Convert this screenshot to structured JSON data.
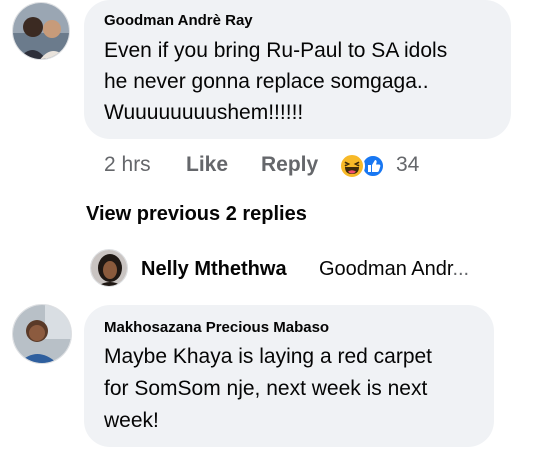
{
  "comments": [
    {
      "author": "Goodman Andrè Ray",
      "lines": [
        "Even if you bring Ru-Paul to SA idols",
        "he never gonna replace somgaga..",
        "Wuuuuuuuushem!!!!!!"
      ],
      "time": "2 hrs",
      "like_label": "Like",
      "reply_label": "Reply",
      "reaction_count": "34",
      "reaction_icons": [
        "haha-reaction-icon",
        "like-reaction-icon"
      ]
    },
    {
      "author": "Makhosazana Precious Mabaso",
      "lines": [
        "Maybe Khaya is laying a red carpet",
        "for SomSom nje, next week is next",
        "week!"
      ]
    }
  ],
  "view_previous_label": "View previous 2 replies",
  "reply_preview": {
    "author": "Nelly Mthethwa",
    "text": "Goodman Andr",
    "ellipsis": "..."
  },
  "colors": {
    "bubble": "#f0f2f5",
    "secondary_text": "#65676b",
    "primary_text": "#050505",
    "like_blue": "#1877f2",
    "haha_yellow": "#f7b928"
  }
}
